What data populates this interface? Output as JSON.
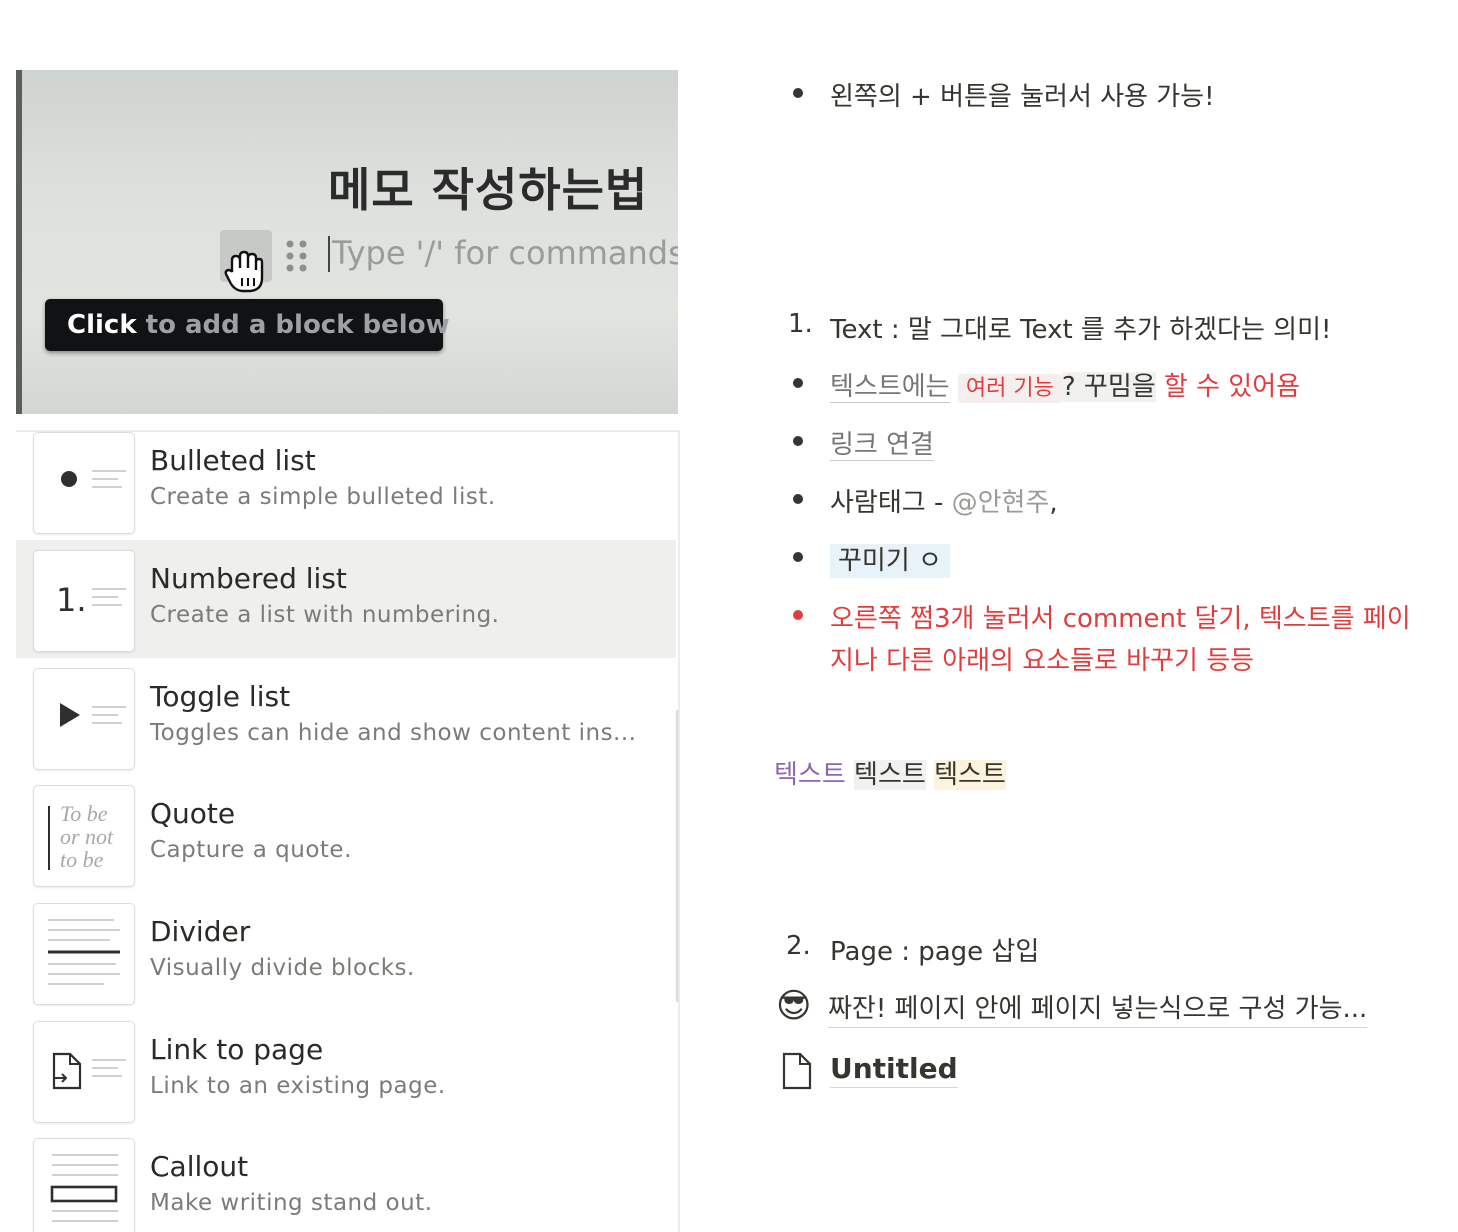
{
  "photo": {
    "title": "메모 작성하는법",
    "placeholder": "Type '/' for commands",
    "tooltip_bold": "Click",
    "tooltip_rest": " to add a block below"
  },
  "menu": {
    "items": [
      {
        "title": "Bulleted list",
        "desc": "Create a simple bulleted list.",
        "icon": "bulleted-list-icon"
      },
      {
        "title": "Numbered list",
        "desc": "Create a list with numbering.",
        "icon": "numbered-list-icon",
        "number": "1."
      },
      {
        "title": "Toggle list",
        "desc": "Toggles can hide and show content ins...",
        "icon": "toggle-list-icon"
      },
      {
        "title": "Quote",
        "desc": "Capture a quote.",
        "icon": "quote-icon",
        "quote_lines": [
          "To be",
          "or not",
          "to be"
        ]
      },
      {
        "title": "Divider",
        "desc": "Visually divide blocks.",
        "icon": "divider-icon"
      },
      {
        "title": "Link to page",
        "desc": "Link to an existing page.",
        "icon": "link-to-page-icon"
      },
      {
        "title": "Callout",
        "desc": "Make writing stand out.",
        "icon": "callout-icon"
      }
    ]
  },
  "notes": {
    "intro_bullet": "왼쪽의 + 버튼을 눌러서 사용 가능!",
    "item1_number": "1.",
    "item1_text": "Text : 말 그대로 Text 를 추가 하겠다는 의미!",
    "text_bullet": {
      "part1": "텍스트에는",
      "chip": "여러  기능",
      "part2": "? 꾸밈을",
      "part3": " 할 수 있어욤"
    },
    "link_bullet": "링크 연결",
    "tag_bullet": {
      "label": "사람태그 - ",
      "mention": "@안현주",
      "suffix": ","
    },
    "deco_bullet": "꾸미기    ㅇ",
    "comment_bullet_line1": "오른쪽 쩜3개 눌러서 comment 달기, 텍스트를 페이",
    "comment_bullet_line2": "지나 다른 아래의 요소들로 바꾸기 등등",
    "styled_words": [
      "텍스트",
      "텍스트",
      "텍스트"
    ],
    "item2_number": "2.",
    "item2_text": "Page : page 삽입",
    "page_link_emoji": "😎",
    "page_link_title": "짜잔! 페이지 안에 페이지 넣는식으로 구성 가능...",
    "untitled_page": "Untitled"
  },
  "colors": {
    "text": "#37352f",
    "red": "#e03e3e",
    "purple": "#9065b0",
    "grey_bg": "#f1f1ef",
    "blue_bg": "#e7f3f8",
    "yellow_bg": "#fbf3db",
    "menu_selected_bg": "#efefee",
    "tooltip_bg": "#111214"
  }
}
